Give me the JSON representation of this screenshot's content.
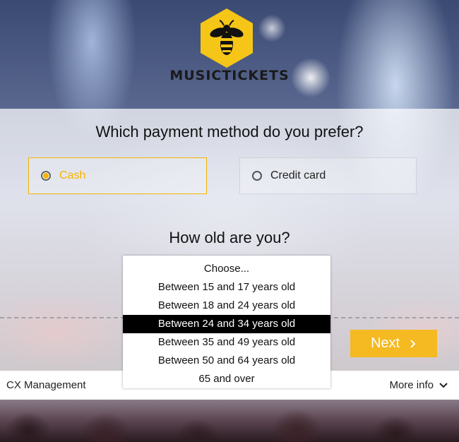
{
  "brand": {
    "name": "MUSICTICKETS",
    "logo_icon": "bee-icon",
    "logo_color": "#f5c518"
  },
  "payment": {
    "question": "Which payment method do you prefer?",
    "options": [
      {
        "label": "Cash",
        "selected": true
      },
      {
        "label": "Credit card",
        "selected": false
      }
    ]
  },
  "age": {
    "question": "How old are you?",
    "dropdown": {
      "open": true,
      "options": [
        "Choose...",
        "Between 15 and 17 years old",
        "Between 18 and 24 years old",
        "Between 24 and 34 years old",
        "Between 35 and 49 years old",
        "Between 50 and 64 years old",
        "65 and over"
      ],
      "highlighted": "Between 24 and 34 years old"
    }
  },
  "next": {
    "label": "Next",
    "icon": "chevron-right-icon",
    "color": "#f5b921"
  },
  "footer": {
    "left": "CX Management",
    "right": "More info",
    "right_icon": "chevron-down-icon"
  },
  "colors": {
    "accent": "#f5b400"
  }
}
